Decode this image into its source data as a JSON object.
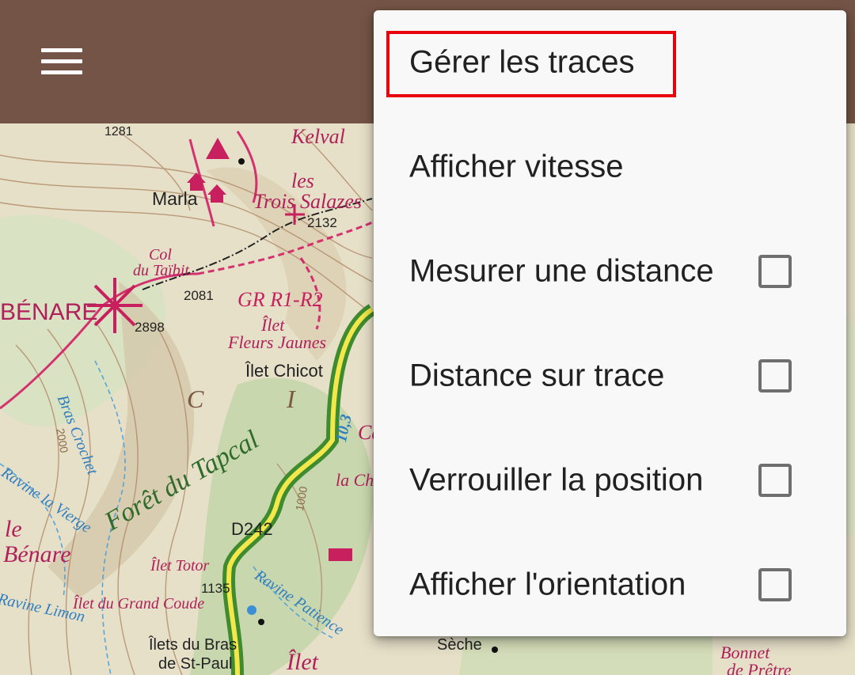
{
  "toolbar": {
    "menu_icon": "hamburger-menu-icon"
  },
  "map": {
    "labels": {
      "kelval": "Kelval",
      "marla": "Marla",
      "les": "les",
      "trois_salazes": "Trois Salazes",
      "col": "Col",
      "du_taibit": "du Taïbit",
      "benare_top": "BÉNARE",
      "gr": "GR R1-R2",
      "ilet": "Îlet",
      "fleurs_jaunes": "Fleurs Jaunes",
      "ilet_chicot": "Îlet Chicot",
      "bras_crochet": "Bras Crochet",
      "foret": "Forêt du Tapcal",
      "ravine_vierge": "Ravine la Vierge",
      "le": "le",
      "benare": "Bénare",
      "d242": "D242",
      "ilet_totor": "Îlet Totor",
      "ilet_grand_coude": "Îlet du Grand Coude",
      "ravine_limon": "Ravine Limon",
      "ilets_bras": "Îlets du Bras",
      "de_st_paul": "de St-Paul",
      "ravine_patience": "Ravine Patience",
      "ilet_bottom": "Îlet",
      "bonnet": "Bonnet",
      "de_pretre": "de Prêtre",
      "seche": "Sèche",
      "c": "C",
      "i": "I",
      "la_ch": "la Ch",
      "ca": "Ca",
      "route_103": "10,3"
    },
    "elevations": {
      "e1281": "1281",
      "e2132": "2132",
      "e2081": "2081",
      "e2898": "2898",
      "e1135": "1135",
      "e1000": "1000",
      "e2000": "2000"
    }
  },
  "menu": {
    "items": [
      {
        "label": "Gérer les traces",
        "highlighted": true
      },
      {
        "label": "Afficher vitesse"
      },
      {
        "label": "Mesurer une distance",
        "checked": false
      },
      {
        "label": "Distance sur trace",
        "checked": false
      },
      {
        "label": "Verrouiller la position",
        "checked": false
      },
      {
        "label": "Afficher l'orientation",
        "checked": false
      }
    ]
  },
  "colors": {
    "appbar": "#745446",
    "menu_bg": "#f8f8f8",
    "highlight": "#e8000c"
  }
}
